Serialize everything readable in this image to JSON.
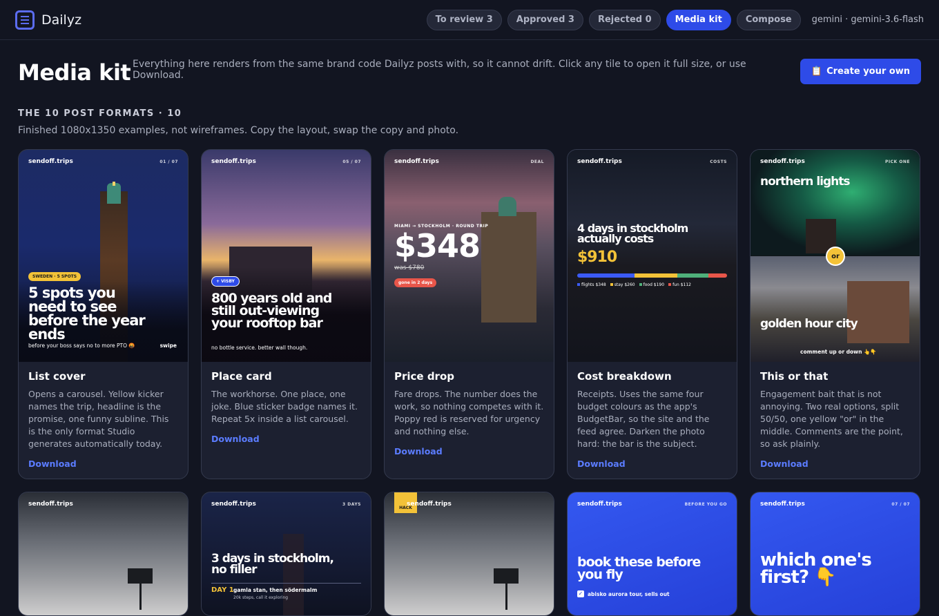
{
  "app": {
    "brand": "Dailyz"
  },
  "nav": {
    "tabs": [
      {
        "label": "To review 3"
      },
      {
        "label": "Approved 3"
      },
      {
        "label": "Rejected 0"
      },
      {
        "label": "Media kit",
        "active": true
      },
      {
        "label": "Compose"
      }
    ],
    "model": "gemini · gemini-3.6-flash"
  },
  "page": {
    "title": "Media kit",
    "intro": "Everything here renders from the same brand code Dailyz posts with, so it cannot drift. Click any tile to open it full size, or use Download.",
    "create_icon": "📋",
    "create_label": "Create your own",
    "section_title": "THE 10 POST FORMATS · 10",
    "section_sub": "Finished 1080x1350 examples, not wireframes. Copy the layout, swap the copy and photo."
  },
  "cards": [
    {
      "title": "List cover",
      "desc": "Opens a carousel. Yellow kicker names the trip, headline is the promise, one funny subline. This is the only format Studio generates automatically today.",
      "download": "Download",
      "tile": {
        "handle": "sendoff.trips",
        "tag": "01 / 07",
        "kicker": "SWEDEN · 5 SPOTS",
        "headline": "5 spots you need to see before the year ends",
        "subline": "before your boss says no to more PTO 🤬",
        "swipe": "swipe"
      }
    },
    {
      "title": "Place card",
      "desc": "The workhorse. One place, one joke. Blue sticker badge names it. Repeat 5x inside a list carousel.",
      "download": "Download",
      "tile": {
        "handle": "sendoff.trips",
        "tag": "05 / 07",
        "badge": "+ VISBY",
        "headline": "800 years old and still out-viewing your rooftop bar",
        "subline": "no bottle service. better wall though."
      }
    },
    {
      "title": "Price drop",
      "desc": "Fare drops. The number does the work, so nothing competes with it. Poppy red is reserved for urgency and nothing else.",
      "download": "Download",
      "tile": {
        "handle": "sendoff.trips",
        "tag": "DEAL",
        "route": "MIAMI → STOCKHOLM · ROUND TRIP",
        "price": "$348",
        "was": "was $780",
        "urgency": "gone in 2 days"
      }
    },
    {
      "title": "Cost breakdown",
      "desc": "Receipts. Uses the same four budget colours as the app's BudgetBar, so the site and the feed agree. Darken the photo hard: the bar is the subject.",
      "download": "Download",
      "tile": {
        "handle": "sendoff.trips",
        "tag": "COSTS",
        "headline": "4 days in stockholm actually costs",
        "total": "$910",
        "legend": [
          {
            "label": "flights $348",
            "color": "#3b5bf5",
            "share": 348
          },
          {
            "label": "stay $260",
            "color": "#f3c238",
            "share": 260
          },
          {
            "label": "food $190",
            "color": "#4fb07a",
            "share": 190
          },
          {
            "label": "fun $112",
            "color": "#e8564a",
            "share": 112
          }
        ]
      }
    },
    {
      "title": "This or that",
      "desc": "Engagement bait that is not annoying. Two real options, split 50/50, one yellow \"or\" in the middle. Comments are the point, so ask plainly.",
      "download": "Download",
      "tile": {
        "handle": "sendoff.trips",
        "tag": "PICK ONE",
        "option_a": "northern lights",
        "or": "or",
        "option_b": "golden hour city",
        "cta": "comment up or down 👆👇"
      }
    }
  ],
  "row2": [
    {
      "handle": "sendoff.trips"
    },
    {
      "handle": "sendoff.trips",
      "tag": "3 DAYS",
      "headline": "3 days in stockholm, no filler",
      "day": "DAY 1",
      "day_text": "gamla stan, then södermalm",
      "day_sub": "20k steps, call it exploring"
    },
    {
      "handle": "sendoff.trips",
      "badge": "HACK"
    },
    {
      "handle": "sendoff.trips",
      "tag": "BEFORE YOU GO",
      "headline": "book these before you fly",
      "check": "abisko aurora tour, sells out"
    },
    {
      "handle": "sendoff.trips",
      "tag": "07 / 07",
      "headline": "which one's first? 👇"
    }
  ]
}
